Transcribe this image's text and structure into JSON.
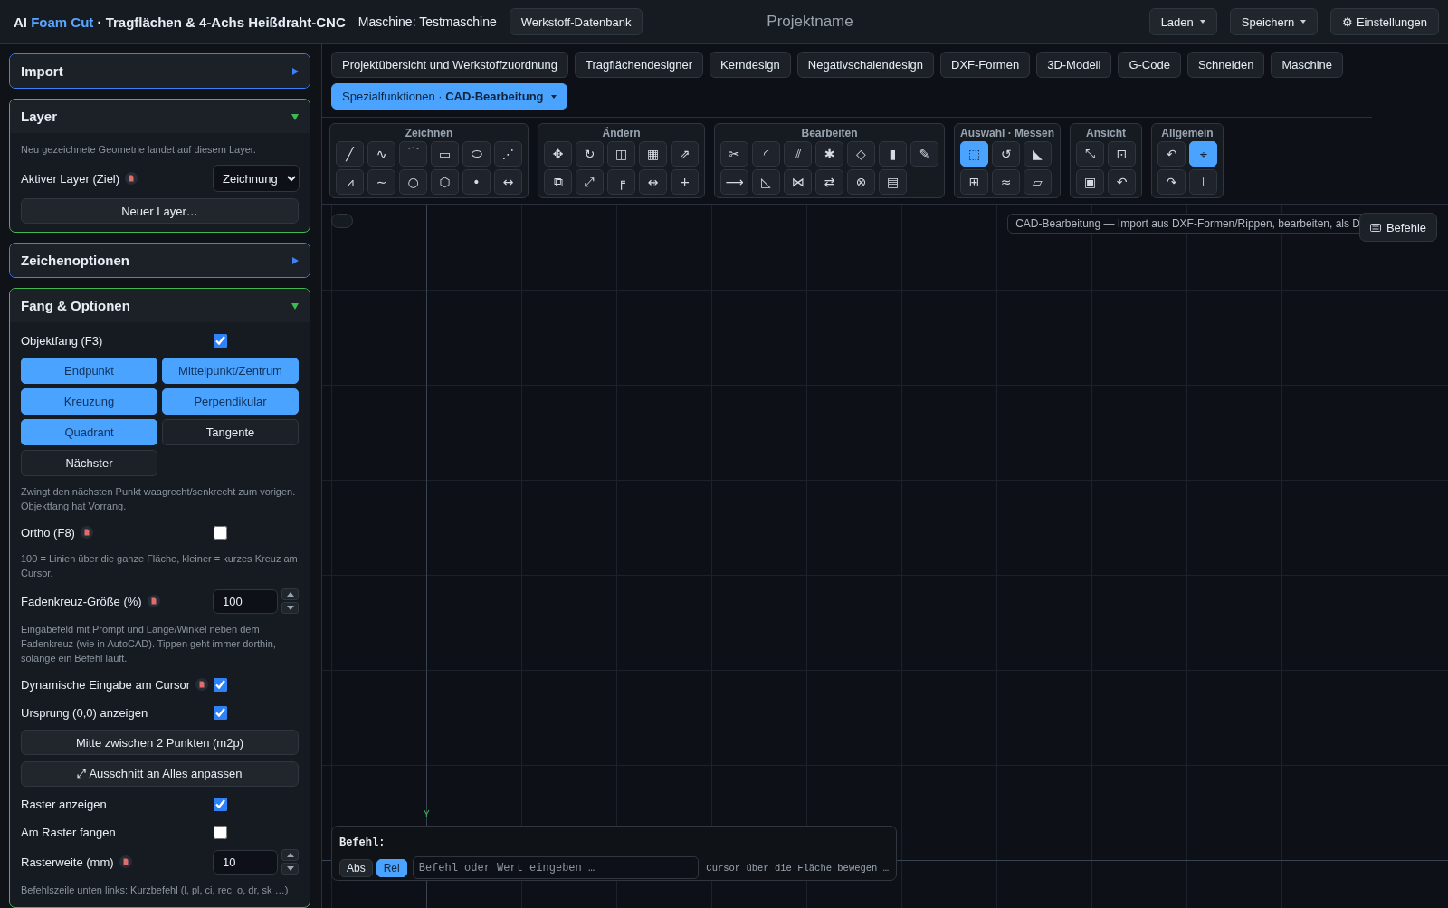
{
  "header": {
    "title": {
      "prefix": "AI",
      "accent": "Foam Cut",
      "suffix": "· Tragflächen & 4-Achs Heißdraht-CNC"
    },
    "machine": "Maschine: Testmaschine",
    "buttons_left": [
      {
        "label": "Werkstoff-Datenbank",
        "dropdown": false
      }
    ],
    "project_name": "Projektname",
    "buttons_right": [
      {
        "label": "Laden",
        "dropdown": true
      },
      {
        "label": "Speichern",
        "dropdown": true
      },
      {
        "label": "⚙ Einstellungen",
        "dropdown": false
      }
    ]
  },
  "sidebar": {
    "panels": [
      {
        "title": "Import",
        "expanded": false
      },
      {
        "title": "Layer",
        "expanded": true,
        "items": [
          {
            "kind": "note",
            "text": "Neu gezeichnete Geometrie landet auf diesem Layer."
          },
          {
            "kind": "select",
            "label": "Aktiver Layer (Ziel)",
            "help": true,
            "value": "Zeichnung"
          },
          {
            "kind": "button",
            "label": "Neuer Layer…"
          }
        ]
      },
      {
        "title": "Zeichenoptionen",
        "expanded": false
      },
      {
        "title": "Fang & Optionen",
        "expanded": true,
        "items": [
          {
            "kind": "checkbox",
            "label": "Objektfang (F3)",
            "help": false,
            "checked": true
          },
          {
            "kind": "toggles",
            "options": [
              {
                "label": "Endpunkt",
                "selected": true
              },
              {
                "label": "Mittelpunkt/Zentrum",
                "selected": true
              },
              {
                "label": "Kreuzung",
                "selected": true
              },
              {
                "label": "Perpendikular",
                "selected": true
              },
              {
                "label": "Quadrant",
                "selected": true
              },
              {
                "label": "Tangente",
                "selected": false
              },
              {
                "label": "Nächster",
                "selected": false
              }
            ]
          },
          {
            "kind": "note",
            "text": "Zwingt den nächsten Punkt waagrecht/senkrecht zum vorigen. Objektfang hat Vorrang."
          },
          {
            "kind": "checkbox",
            "label": "Ortho (F8)",
            "help": true,
            "checked": false
          },
          {
            "kind": "note",
            "text": "100 = Linien über die ganze Fläche, kleiner = kurzes Kreuz am Cursor."
          },
          {
            "kind": "number",
            "label": "Fadenkreuz-Größe (%)",
            "help": true,
            "value": "100"
          },
          {
            "kind": "note",
            "text": "Eingabefeld mit Prompt und Länge/Winkel neben dem Fadenkreuz (wie in AutoCAD). Tippen geht immer dorthin, solange ein Befehl läuft."
          },
          {
            "kind": "checkbox",
            "label": "Dynamische Eingabe am Cursor",
            "help": true,
            "checked": true
          },
          {
            "kind": "checkbox",
            "label": "Ursprung (0,0) anzeigen",
            "help": false,
            "checked": true
          },
          {
            "kind": "button",
            "label": "Mitte zwischen 2 Punkten (m2p)"
          },
          {
            "kind": "button",
            "label": "⤢ Ausschnitt an Alles anpassen"
          },
          {
            "kind": "checkbox",
            "label": "Raster anzeigen",
            "help": false,
            "checked": true
          },
          {
            "kind": "checkbox",
            "label": "Am Raster fangen",
            "help": false,
            "checked": false
          },
          {
            "kind": "number",
            "label": "Rasterweite (mm)",
            "help": true,
            "value": "10"
          },
          {
            "kind": "note",
            "text": "Befehlszeile unten links: Kurzbefehl (l, pl, ci, rec, o, dr, sk …)"
          }
        ]
      }
    ]
  },
  "tabs": [
    {
      "label": "Projektübersicht und Werkstoffzuordnung",
      "selected": false,
      "dropdown": false
    },
    {
      "label": "Tragflächendesigner",
      "selected": false,
      "dropdown": false
    },
    {
      "label": "Kerndesign",
      "selected": false,
      "dropdown": false
    },
    {
      "label": "Negativschalendesign",
      "selected": false,
      "dropdown": false
    },
    {
      "label": "DXF-Formen",
      "selected": false,
      "dropdown": false
    },
    {
      "label": "3D-Modell",
      "selected": false,
      "dropdown": false
    },
    {
      "label": "G-Code",
      "selected": false,
      "dropdown": false
    },
    {
      "label": "Schneiden",
      "selected": false,
      "dropdown": false
    },
    {
      "label": "Maschine",
      "selected": false,
      "dropdown": false
    },
    {
      "label": "Spezialfunktionen · **CAD-Bearbeitung**",
      "selected": true,
      "dropdown": true
    }
  ],
  "toolbar": {
    "groups": [
      {
        "title": "Zeichnen",
        "tools": [
          {
            "glyph": "╱",
            "selected": false
          },
          {
            "glyph": "∿",
            "selected": false
          },
          {
            "glyph": "⌒",
            "selected": false
          },
          {
            "glyph": "▭",
            "selected": false
          },
          {
            "glyph": "⬭",
            "selected": false
          },
          {
            "glyph": "⋰",
            "selected": false
          },
          {
            "glyph": "⩘",
            "selected": false
          },
          {
            "glyph": "∼",
            "selected": false
          },
          {
            "glyph": "○",
            "selected": false
          },
          {
            "glyph": "⬡",
            "selected": false
          },
          {
            "glyph": "•",
            "selected": false
          },
          {
            "glyph": "↔",
            "selected": false
          }
        ]
      },
      {
        "title": "Ändern",
        "tools": [
          {
            "glyph": "✥",
            "selected": false
          },
          {
            "glyph": "↻",
            "selected": false
          },
          {
            "glyph": "◫",
            "selected": false
          },
          {
            "glyph": "▦",
            "selected": false
          },
          {
            "glyph": "⇗",
            "selected": false
          },
          {
            "glyph": "⧉",
            "selected": false
          },
          {
            "glyph": "⤢",
            "selected": false
          },
          {
            "glyph": "╒",
            "selected": false
          },
          {
            "glyph": "⇹",
            "selected": false
          },
          {
            "glyph": "+",
            "selected": false
          }
        ]
      },
      {
        "title": "Bearbeiten",
        "tools": [
          {
            "glyph": "✂",
            "selected": false
          },
          {
            "glyph": "◜",
            "selected": false
          },
          {
            "glyph": "⫽",
            "selected": false
          },
          {
            "glyph": "✱",
            "selected": false
          },
          {
            "glyph": "◇",
            "selected": false
          },
          {
            "glyph": "▮",
            "selected": false
          },
          {
            "glyph": "✎",
            "selected": false
          },
          {
            "glyph": "⟶",
            "selected": false
          },
          {
            "glyph": "◺",
            "selected": false
          },
          {
            "glyph": "⋈",
            "selected": false
          },
          {
            "glyph": "⇄",
            "selected": false
          },
          {
            "glyph": "⊗",
            "selected": false
          },
          {
            "glyph": "▤",
            "selected": false
          }
        ]
      },
      {
        "title": "Auswahl · Messen",
        "tools": [
          {
            "glyph": "⬚",
            "selected": true
          },
          {
            "glyph": "↺",
            "selected": false
          },
          {
            "glyph": "◣",
            "selected": false
          },
          {
            "glyph": "⊞",
            "selected": false
          },
          {
            "glyph": "≈",
            "selected": false
          },
          {
            "glyph": "▱",
            "selected": false
          }
        ]
      },
      {
        "title": "Ansicht",
        "tools": [
          {
            "glyph": "⤡",
            "selected": false
          },
          {
            "glyph": "⊡",
            "selected": false
          },
          {
            "glyph": "▣",
            "selected": false
          },
          {
            "glyph": "↶",
            "selected": false
          }
        ]
      },
      {
        "title": "Allgemein",
        "tools": [
          {
            "glyph": "↶",
            "selected": false
          },
          {
            "glyph": "⌖",
            "selected": true
          },
          {
            "glyph": "↷",
            "selected": false
          },
          {
            "glyph": "⊥",
            "selected": false
          }
        ]
      }
    ]
  },
  "canvas": {
    "toggle": {
      "on": false
    },
    "banner": "CAD-Bearbeitung — Import aus DXF-Formen/Rippen, bearbeiten, als D",
    "commands_button": "Befehle",
    "y_axis_label": "Y",
    "command_line": {
      "label": "Befehl:",
      "modes": [
        {
          "label": "Abs",
          "selected": false
        },
        {
          "label": "Rel",
          "selected": true
        }
      ],
      "placeholder": "Befehl oder Wert eingeben …",
      "status": "Cursor über die Fläche bewegen …"
    }
  }
}
